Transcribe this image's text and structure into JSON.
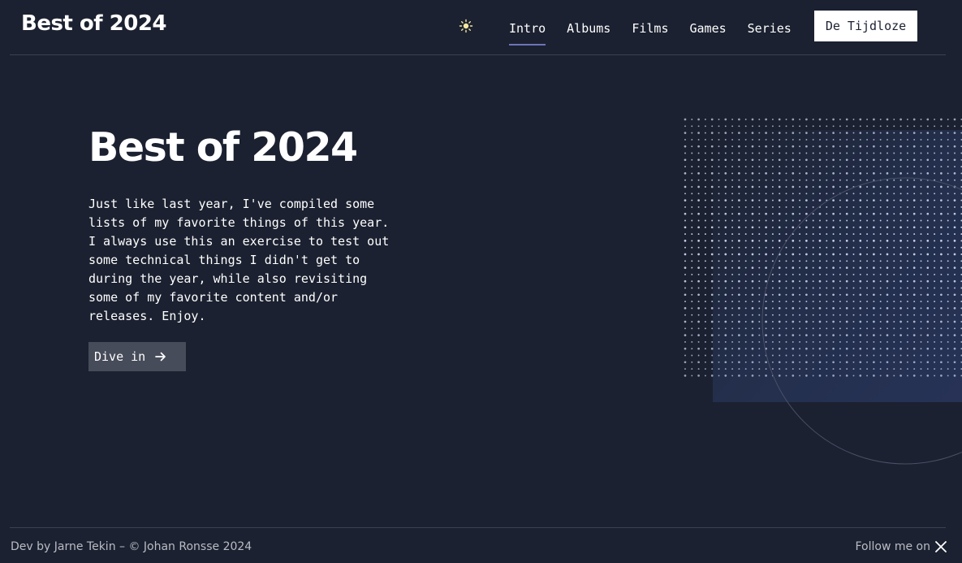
{
  "header": {
    "brand": "Best of 2024",
    "theme_toggle_icon": "sun-icon",
    "nav": [
      {
        "label": "Intro",
        "active": true
      },
      {
        "label": "Albums",
        "active": false
      },
      {
        "label": "Films",
        "active": false
      },
      {
        "label": "Games",
        "active": false
      },
      {
        "label": "Series",
        "active": false
      }
    ],
    "cta_label": "De Tijdloze"
  },
  "hero": {
    "title": "Best of 2024",
    "lines": [
      "Just like last year, I've compiled some",
      "lists of my favorite things of this year.",
      "I always use this an exercise to test out",
      "some technical things I didn't get to",
      "during the year, while also revisiting",
      "some of my favorite content and/or",
      "releases. Enjoy."
    ],
    "button_label": "Dive in",
    "button_icon": "arrow-right-icon"
  },
  "footer": {
    "credit": "Dev by Jarne Tekin – © Johan Ronsse 2024",
    "follow_label": "Follow me on",
    "follow_icon": "x-logo-icon"
  },
  "colors": {
    "background": "#1b2130",
    "accent": "#6d74b8",
    "button_bg": "#474c5a"
  }
}
